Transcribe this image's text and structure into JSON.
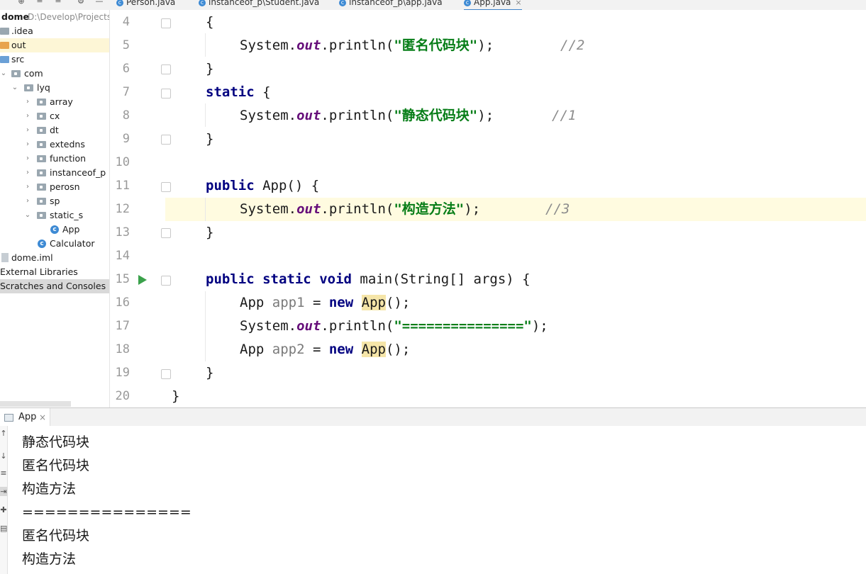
{
  "tabs": [
    {
      "label": "Person.java"
    },
    {
      "label": "instanceof_p\\Student.java"
    },
    {
      "label": "instanceof_p\\app.java"
    },
    {
      "label": "App.java",
      "active": true
    }
  ],
  "project": {
    "root_name": "dome",
    "root_path": "D:\\Develop\\Projects",
    "items": [
      {
        "label": ".idea"
      },
      {
        "label": "out"
      },
      {
        "label": "src"
      },
      {
        "label": "com"
      },
      {
        "label": "lyq"
      },
      {
        "label": "array"
      },
      {
        "label": "cx"
      },
      {
        "label": "dt"
      },
      {
        "label": "extedns"
      },
      {
        "label": "function"
      },
      {
        "label": "instanceof_p"
      },
      {
        "label": "perosn"
      },
      {
        "label": "sp"
      },
      {
        "label": "static_s"
      },
      {
        "label": "App"
      },
      {
        "label": "Calculator"
      },
      {
        "label": "dome.iml"
      },
      {
        "label": "External Libraries"
      },
      {
        "label": "Scratches and Consoles"
      }
    ]
  },
  "editor": {
    "current_line": 12,
    "lines": [
      {
        "no": "4"
      },
      {
        "no": "5"
      },
      {
        "no": "6"
      },
      {
        "no": "7"
      },
      {
        "no": "8"
      },
      {
        "no": "9"
      },
      {
        "no": "10"
      },
      {
        "no": "11"
      },
      {
        "no": "12"
      },
      {
        "no": "13"
      },
      {
        "no": "14"
      },
      {
        "no": "15"
      },
      {
        "no": "16"
      },
      {
        "no": "17"
      },
      {
        "no": "18"
      },
      {
        "no": "19"
      },
      {
        "no": "20"
      }
    ],
    "tokens": {
      "brace_open": "{",
      "brace_close": "}",
      "system": "System.",
      "out": "out",
      "println": ".println(",
      "str_anon": "\"匿名代码块\"",
      "str_static": "\"静态代码块\"",
      "str_ctor": "\"构造方法\"",
      "str_sep": "\"===============\"",
      "close_paren": ");",
      "cmt_2": "//2",
      "cmt_1": "//1",
      "cmt_3": "//3",
      "kw_static": "static",
      "kw_public": "public",
      "kw_void": "void",
      "kw_new": "new",
      "ctor_sig": " App() {",
      "main_sig": " main(String[] args) {",
      "type_app": "App ",
      "var_app1": "app1",
      "var_app2": "app2",
      "assign": " = ",
      "app_call": "App",
      "call_end": "();"
    }
  },
  "run_panel": {
    "tab_label": "App",
    "output": [
      "静态代码块",
      "匿名代码块",
      "构造方法",
      "===============",
      "匿名代码块",
      "构造方法"
    ]
  }
}
